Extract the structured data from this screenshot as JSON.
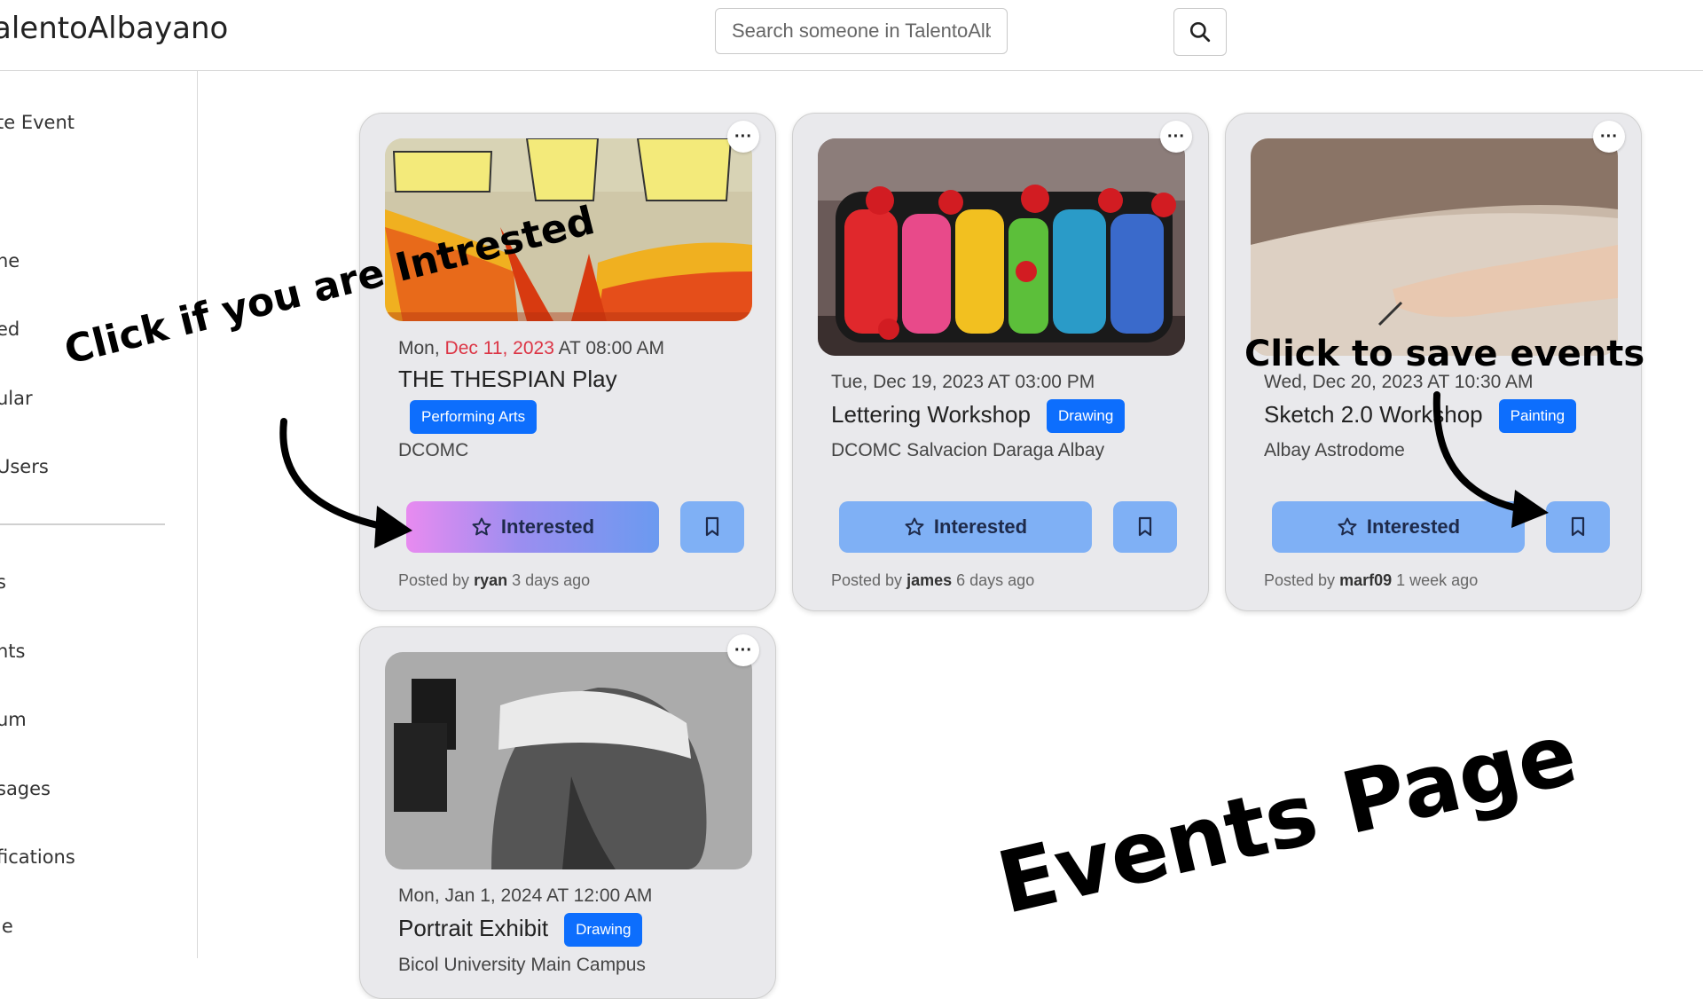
{
  "brand": "alentoAlbayano",
  "search": {
    "placeholder": "Search someone in TalentoAlbayano..."
  },
  "sidebar": {
    "items": [
      {
        "label": "te Event"
      },
      {
        "label": "ne"
      },
      {
        "label": "ed"
      },
      {
        "label": "ular"
      },
      {
        "label": "Users"
      },
      {
        "label": "s"
      },
      {
        "label": "nts"
      },
      {
        "label": "um"
      },
      {
        "label": "sages"
      },
      {
        "label": "fications"
      },
      {
        "label": "le"
      }
    ]
  },
  "events": [
    {
      "date_partial": "Mon, ",
      "date_red": "Dec 11, 2023",
      "date_rest": " AT 08:00 AM",
      "title": "THE THESPIAN Play",
      "category": "Performing Arts",
      "venue": "DCOMC",
      "interested_label": "Interested",
      "posted_by_prefix": "Posted by",
      "author": "ryan",
      "time_ago": "3 days ago",
      "image": "orange-flame-wings-artwork"
    },
    {
      "date": "Tue, Dec 19, 2023 AT 03:00 PM",
      "title": "Lettering Workshop",
      "category": "Drawing",
      "venue": "DCOMC Salvacion Daraga Albay",
      "interested_label": "Interested",
      "posted_by_prefix": "Posted by",
      "author": "james",
      "time_ago": "6 days ago",
      "image": "celine-lettering-artwork"
    },
    {
      "date": "Wed, Dec 20, 2023 AT 10:30 AM",
      "title": "Sketch 2.0 Workshop",
      "category": "Painting",
      "venue": "Albay Astrodome",
      "interested_label": "Interested",
      "posted_by_prefix": "Posted by",
      "author": "marf09",
      "time_ago": "1 week ago",
      "image": "hand-sketching-photo"
    },
    {
      "date": "Mon, Jan 1, 2024 AT 12:00 AM",
      "title": "Portrait Exhibit",
      "category": "Drawing",
      "venue": "Bicol University Main Campus",
      "image": "blindfolded-portrait-drawing"
    }
  ],
  "annotations": {
    "interested_hint": "Click  if you are Intrested",
    "save_hint": "Click to save events",
    "page_label": "Events Page"
  },
  "colors": {
    "badge": "#0d6efd",
    "button": "#7fb0f5",
    "card_bg": "#e9e9ec",
    "date_highlight": "#dc3545"
  }
}
